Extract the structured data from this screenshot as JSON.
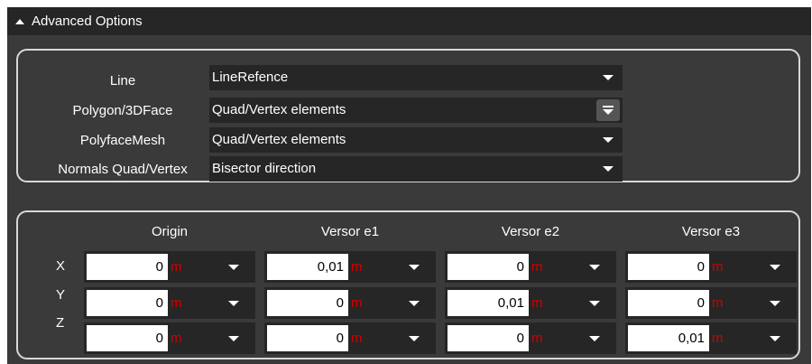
{
  "panel": {
    "title": "Advanced Options"
  },
  "options": [
    {
      "label": "Line",
      "value": "LineRefence"
    },
    {
      "label": "Polygon/3DFace",
      "value": "Quad/Vertex elements"
    },
    {
      "label": "PolyfaceMesh",
      "value": "Quad/Vertex elements"
    },
    {
      "label": "Normals Quad/Vertex",
      "value": "Bisector direction"
    }
  ],
  "grid": {
    "columns": [
      "Origin",
      "Versor e1",
      "Versor e2",
      "Versor e3"
    ],
    "axes": [
      "X",
      "Y",
      "Z"
    ],
    "unit": "m",
    "values": {
      "origin": [
        "0",
        "0",
        "0"
      ],
      "e1": [
        "0,01",
        "0",
        "0"
      ],
      "e2": [
        "0",
        "0,01",
        "0"
      ],
      "e3": [
        "0",
        "0",
        "0,01"
      ]
    }
  },
  "colors": {
    "panel_bg": "#3a3a3a",
    "dropdown_bg": "#262626",
    "unit_color": "#d10000",
    "border": "#d8d8d8"
  }
}
